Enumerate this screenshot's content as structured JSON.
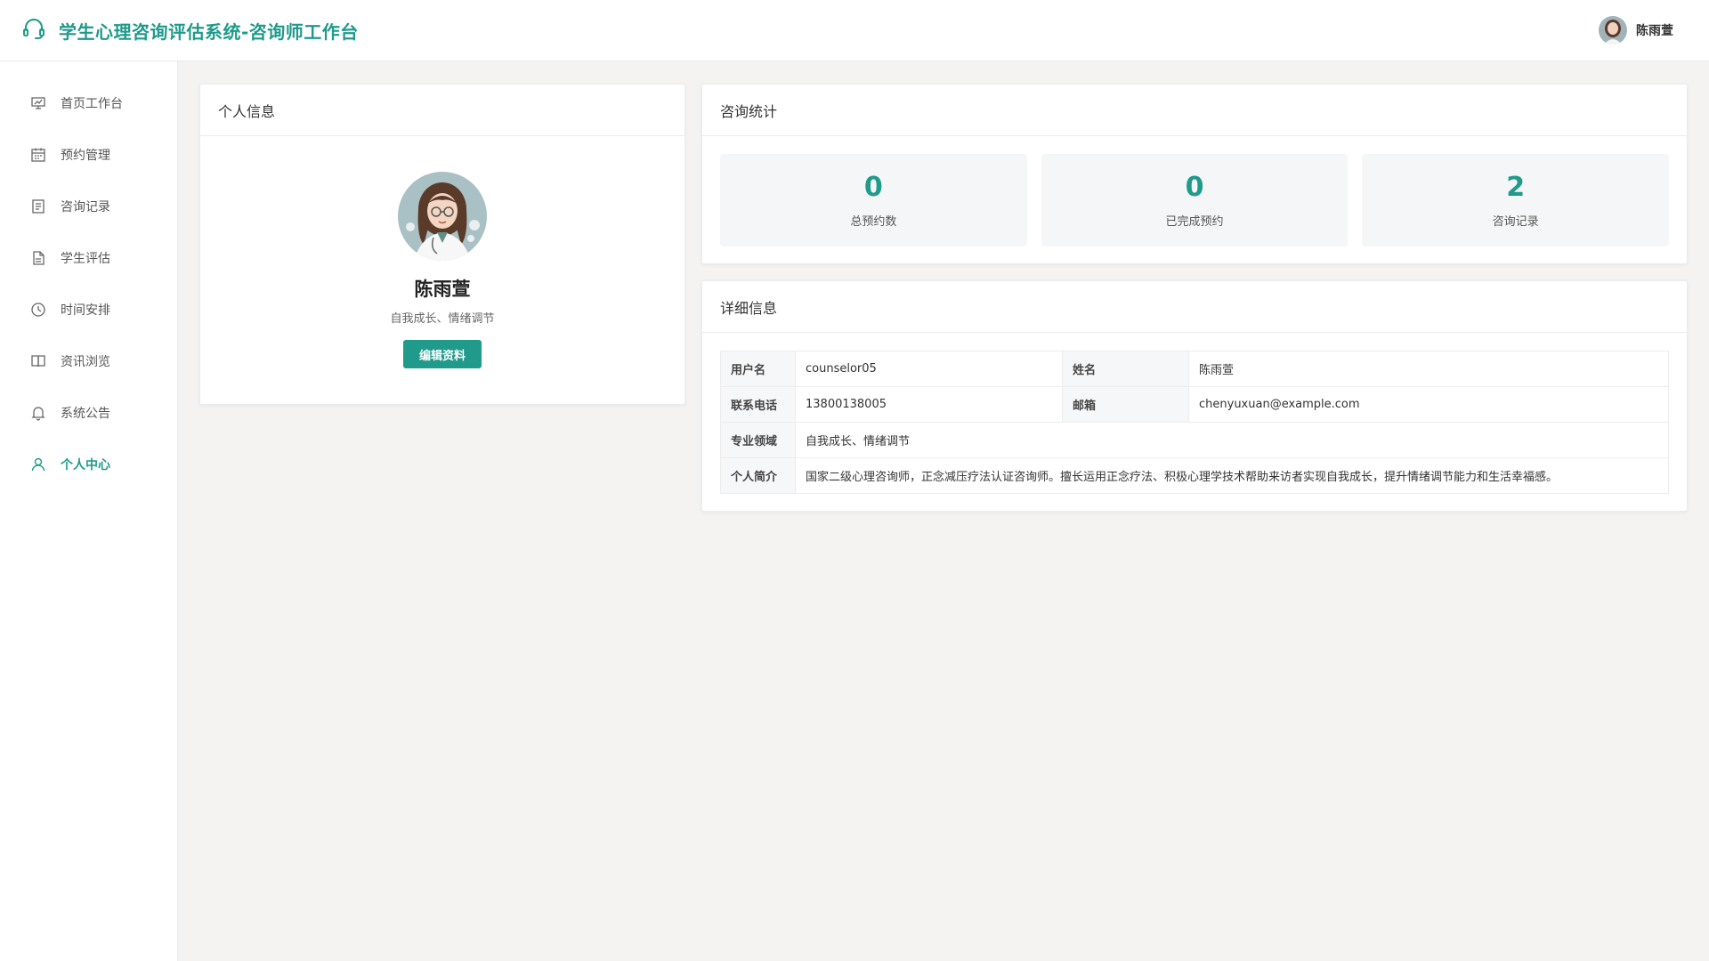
{
  "header": {
    "title": "学生心理咨询评估系统-咨询师工作台",
    "user_name": "陈雨萱"
  },
  "sidebar": {
    "items": [
      {
        "label": "首页工作台",
        "icon": "chart-board-icon"
      },
      {
        "label": "预约管理",
        "icon": "calendar-icon"
      },
      {
        "label": "咨询记录",
        "icon": "record-list-icon"
      },
      {
        "label": "学生评估",
        "icon": "document-icon"
      },
      {
        "label": "时间安排",
        "icon": "clock-icon"
      },
      {
        "label": "资讯浏览",
        "icon": "book-icon"
      },
      {
        "label": "系统公告",
        "icon": "bell-icon"
      },
      {
        "label": "个人中心",
        "icon": "user-icon",
        "active": true
      }
    ]
  },
  "profile_card": {
    "title": "个人信息",
    "name": "陈雨萱",
    "specialty": "自我成长、情绪调节",
    "edit_button": "编辑资料"
  },
  "stats_card": {
    "title": "咨询统计",
    "items": [
      {
        "value": "0",
        "label": "总预约数"
      },
      {
        "value": "0",
        "label": "已完成预约"
      },
      {
        "value": "2",
        "label": "咨询记录"
      }
    ]
  },
  "details_card": {
    "title": "详细信息",
    "username_label": "用户名",
    "username_value": "counselor05",
    "name_label": "姓名",
    "name_value": "陈雨萱",
    "phone_label": "联系电话",
    "phone_value": "13800138005",
    "email_label": "邮箱",
    "email_value": "chenyuxuan@example.com",
    "field_label": "专业领域",
    "field_value": "自我成长、情绪调节",
    "bio_label": "个人简介",
    "bio_value": "国家二级心理咨询师，正念减压疗法认证咨询师。擅长运用正念疗法、积极心理学技术帮助来访者实现自我成长，提升情绪调节能力和生活幸福感。"
  },
  "colors": {
    "accent": "#1f9a8b",
    "page_bg": "#f4f3f1",
    "stat_bg": "#f4f6f8"
  }
}
